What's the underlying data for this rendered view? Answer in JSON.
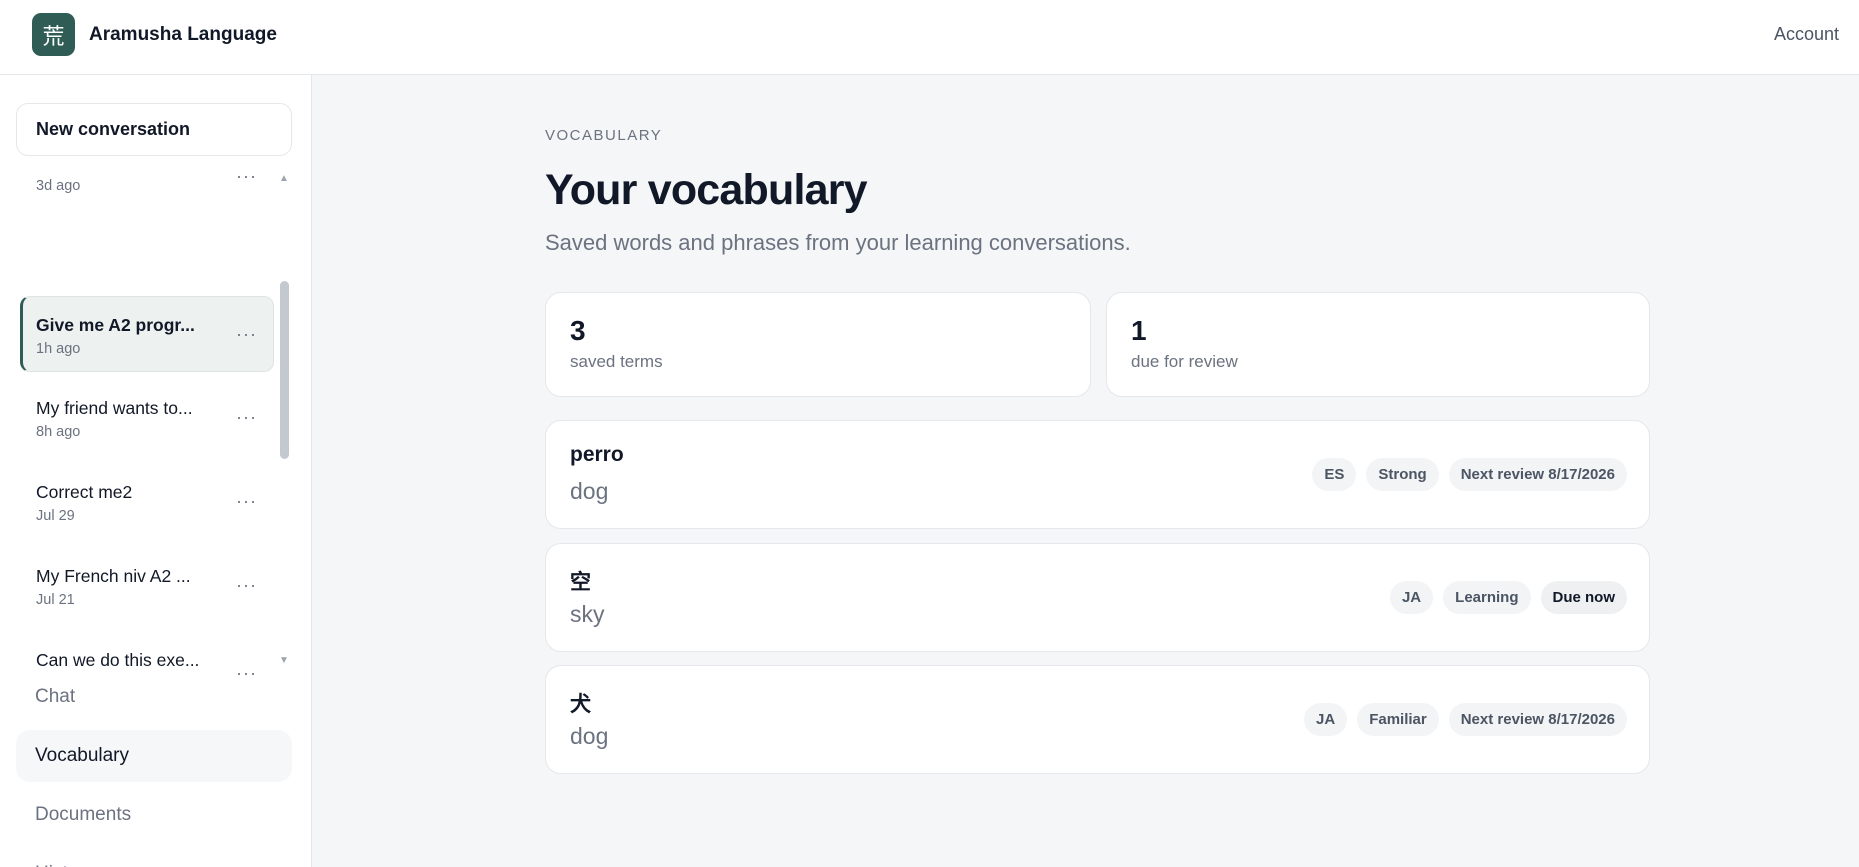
{
  "app": {
    "logo_glyph": "荒",
    "name": "Aramusha Language",
    "account_label": "Account"
  },
  "sidebar": {
    "new_conversation_label": "New conversation",
    "conversations": [
      {
        "title": "",
        "time": "3d ago"
      },
      {
        "title": "Give me A2 progr...",
        "time": "1h ago",
        "active": true
      },
      {
        "title": "My friend wants to...",
        "time": "8h ago"
      },
      {
        "title": "Correct me2",
        "time": "Jul 29"
      },
      {
        "title": "My French niv A2 ...",
        "time": "Jul 21"
      },
      {
        "title": "Can we do this exe...",
        "time": ""
      }
    ],
    "more_glyph": "···",
    "nav": [
      {
        "label": "Chat"
      },
      {
        "label": "Vocabulary",
        "active": true
      },
      {
        "label": "Documents"
      },
      {
        "label": "History"
      }
    ]
  },
  "page": {
    "eyebrow": "VOCABULARY",
    "title": "Your vocabulary",
    "subtitle": "Saved words and phrases from your learning conversations."
  },
  "stats": [
    {
      "value": "3",
      "label": "saved terms"
    },
    {
      "value": "1",
      "label": "due for review"
    }
  ],
  "vocabulary": [
    {
      "term": "perro",
      "meaning": "dog",
      "lang": "ES",
      "strength": "Strong",
      "review": "Next review 8/17/2026",
      "due": false
    },
    {
      "term": "空",
      "meaning": "sky",
      "lang": "JA",
      "strength": "Learning",
      "review": "Due now",
      "due": true
    },
    {
      "term": "犬",
      "meaning": "dog",
      "lang": "JA",
      "strength": "Familiar",
      "review": "Next review 8/17/2026",
      "due": false
    }
  ],
  "colors": {
    "brand": "#2f5d55",
    "background": "#f4f6f7",
    "text": "#111827",
    "muted": "#6b7280"
  },
  "icons": {
    "more": "more-horizontal-icon",
    "scroll_up": "chevron-up-icon",
    "scroll_down": "chevron-down-icon"
  }
}
